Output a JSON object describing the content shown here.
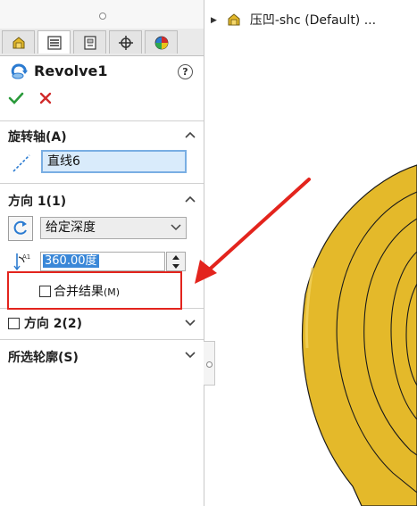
{
  "panel": {
    "tabs": [
      {
        "icon": "feature-manager-icon"
      },
      {
        "icon": "property-manager-icon"
      },
      {
        "icon": "configuration-manager-icon"
      },
      {
        "icon": "dimxpert-icon"
      },
      {
        "icon": "display-manager-icon"
      }
    ],
    "feature_title": "Revolve1",
    "help_glyph": "?",
    "actions": {
      "ok_icon": "checkmark-icon",
      "cancel_icon": "close-icon"
    },
    "axis_section": {
      "title": "旋转轴(A)",
      "axis_value": "直线6"
    },
    "direction1_section": {
      "title": "方向 1(1)",
      "end_condition": "给定深度",
      "angle_value": "360.00度",
      "merge_label": "合并结果",
      "merge_shortcut": "(M)",
      "merge_checked": false
    },
    "direction2_section": {
      "title": "方向 2(2)",
      "checked": false
    },
    "contours_section": {
      "title": "所选轮廓(S)"
    }
  },
  "feature_tree": {
    "part_name": "压凹-shc  (Default) ..."
  },
  "colors": {
    "annotation_red": "#e3241d",
    "model_yellow": "#e4b92a",
    "selection_blue": "#d9ebfb"
  }
}
